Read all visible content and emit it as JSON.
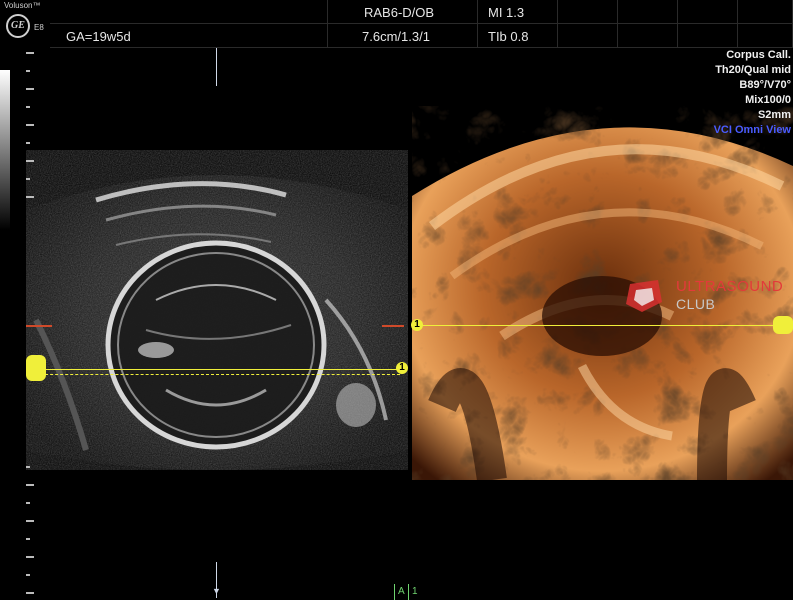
{
  "header": {
    "brand_top": "Voluson™",
    "brand_logo": "GE",
    "brand_model": "E8",
    "gestational_age": "GA=19w5d",
    "probe_preset": "RAB6-D/OB",
    "depth_info": "7.6cm/1.3/1",
    "mi": "MI 1.3",
    "tib": "TIb 0.8"
  },
  "params": {
    "line1": "Corpus Call.",
    "line2": "Th20/Qual mid",
    "line3": "B89°/V70°",
    "line4": "Mix100/0",
    "line5": "S2mm",
    "line6": "VCI Omni View"
  },
  "markers": {
    "left_marker_number": "1",
    "right_marker_number": "1"
  },
  "watermark": {
    "line1": "ULTRASOUND",
    "line2": "CLUB"
  },
  "footer": {
    "view_label": "A",
    "view_number": "1"
  },
  "colors": {
    "marker": "#f0ef3a",
    "accent_blue": "#4a5cff",
    "watermark_red": "#e33a3a",
    "footer_green": "#6fd36f"
  }
}
